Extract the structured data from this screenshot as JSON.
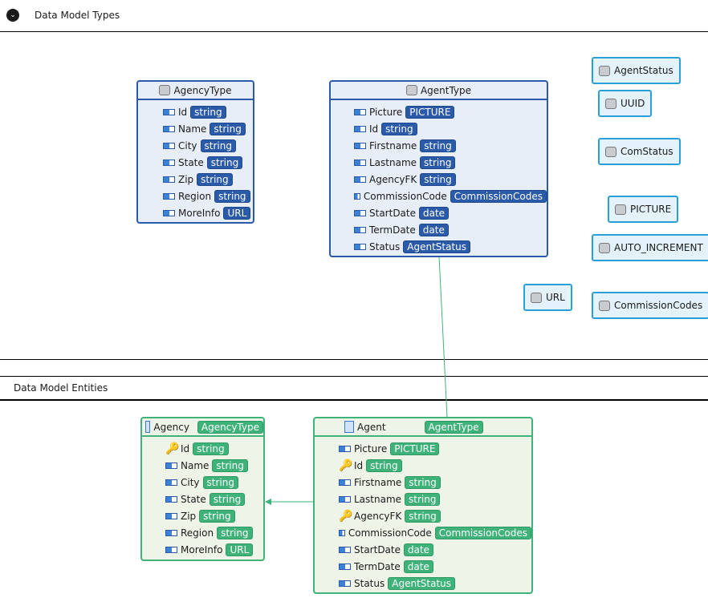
{
  "sections": {
    "types": "Data Model Types",
    "entities": "Data Model Entities"
  },
  "types": {
    "agency": {
      "name": "AgencyType",
      "fields": [
        [
          "Id",
          "string"
        ],
        [
          "Name",
          "string"
        ],
        [
          "City",
          "string"
        ],
        [
          "State",
          "string"
        ],
        [
          "Zip",
          "string"
        ],
        [
          "Region",
          "string"
        ],
        [
          "MoreInfo",
          "URL"
        ]
      ]
    },
    "agent": {
      "name": "AgentType",
      "fields": [
        [
          "Picture",
          "PICTURE"
        ],
        [
          "Id",
          "string"
        ],
        [
          "Firstname",
          "string"
        ],
        [
          "Lastname",
          "string"
        ],
        [
          "AgencyFK",
          "string"
        ],
        [
          "CommissionCode",
          "CommissionCodes"
        ],
        [
          "StartDate",
          "date"
        ],
        [
          "TermDate",
          "date"
        ],
        [
          "Status",
          "AgentStatus"
        ]
      ]
    },
    "simple": [
      "AgentStatus",
      "UUID",
      "ComStatus",
      "PICTURE",
      "AUTO_INCREMENT",
      "URL",
      "CommissionCodes"
    ]
  },
  "entities": {
    "agency": {
      "name": "Agency",
      "type": "AgencyType",
      "fields": [
        [
          "Id",
          "string",
          "key"
        ],
        [
          "Name",
          "string",
          "field"
        ],
        [
          "City",
          "string",
          "field"
        ],
        [
          "State",
          "string",
          "field"
        ],
        [
          "Zip",
          "string",
          "field"
        ],
        [
          "Region",
          "string",
          "field"
        ],
        [
          "MoreInfo",
          "URL",
          "field"
        ]
      ]
    },
    "agent": {
      "name": "Agent",
      "type": "AgentType",
      "fields": [
        [
          "Picture",
          "PICTURE",
          "field"
        ],
        [
          "Id",
          "string",
          "key"
        ],
        [
          "Firstname",
          "string",
          "field"
        ],
        [
          "Lastname",
          "string",
          "field"
        ],
        [
          "AgencyFK",
          "string",
          "fk"
        ],
        [
          "CommissionCode",
          "CommissionCodes",
          "field"
        ],
        [
          "StartDate",
          "date",
          "field"
        ],
        [
          "TermDate",
          "date",
          "field"
        ],
        [
          "Status",
          "AgentStatus",
          "field"
        ]
      ]
    }
  },
  "colors": {
    "type_border": "#2a5aa8",
    "entity_border": "#3fb27a",
    "simple_type_border": "#2aa0d8"
  }
}
